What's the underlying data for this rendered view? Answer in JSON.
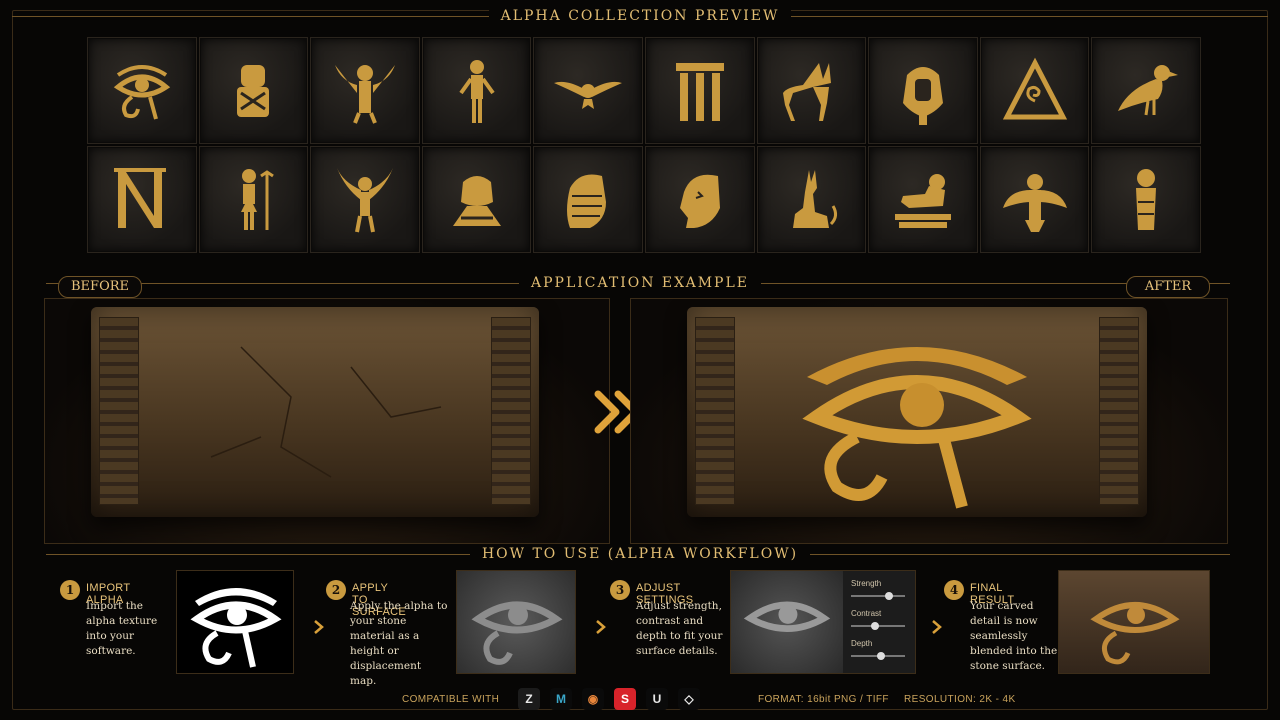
{
  "collection": {
    "title": "ALPHA COLLECTION PREVIEW",
    "icons": [
      "eye-of-horus-icon",
      "seated-pharaoh-icon",
      "winged-figure-icon",
      "standing-god-icon",
      "winged-scarab-icon",
      "column-icon",
      "anubis-jackal-icon",
      "pharaoh-mask-icon",
      "triangle-spiral-icon",
      "falcon-icon",
      "n-letter-icon",
      "standing-figure-staff-icon",
      "winged-goddess-icon",
      "pharaoh-arms-crossed-icon",
      "pharaoh-profile-icon",
      "queen-profile-icon",
      "sitting-jackal-icon",
      "sphinx-icon",
      "winged-idol-icon",
      "mummy-icon"
    ]
  },
  "application": {
    "title": "APPLICATION EXAMPLE",
    "before_label": "BEFORE",
    "after_label": "AFTER"
  },
  "workflow": {
    "title": "HOW TO USE (ALPHA WORKFLOW)",
    "steps": [
      {
        "number": "1",
        "title": "IMPORT ALPHA",
        "description": "Import the alpha texture into your software."
      },
      {
        "number": "2",
        "title": "APPLY TO SURFACE",
        "description": "Apply the alpha to your stone material as a height or displacement map."
      },
      {
        "number": "3",
        "title": "ADJUST SETTINGS",
        "description": "Adjust strength, contrast and depth to fit your surface details."
      },
      {
        "number": "4",
        "title": "FINAL RESULT",
        "description": "Your carved detail is now seamlessly blended into the stone surface."
      }
    ],
    "sliders": [
      {
        "label": "Strength",
        "value": 0.7
      },
      {
        "label": "Contrast",
        "value": 0.45
      },
      {
        "label": "Depth",
        "value": 0.55
      }
    ]
  },
  "footer": {
    "compatible_label": "COMPATIBLE WITH",
    "software": [
      {
        "name": "zbrush-icon",
        "glyph": "Z",
        "bg": "#1b1b1b",
        "fg": "#e8e8e8"
      },
      {
        "name": "maya-icon",
        "glyph": "M",
        "bg": "#0a0a0a",
        "fg": "#3aa7c9"
      },
      {
        "name": "blender-icon",
        "glyph": "◉",
        "bg": "#0a0a0a",
        "fg": "#e8853a"
      },
      {
        "name": "substance-icon",
        "glyph": "S",
        "bg": "#d8232a",
        "fg": "#ffffff"
      },
      {
        "name": "unreal-icon",
        "glyph": "U",
        "bg": "#0a0a0a",
        "fg": "#e8e8e8"
      },
      {
        "name": "unity-icon",
        "glyph": "◇",
        "bg": "#0a0a0a",
        "fg": "#e8e8e8"
      }
    ],
    "format": "FORMAT: 16bit PNG / TIFF",
    "resolution": "RESOLUTION: 2K - 4K"
  },
  "colors": {
    "gold": "#c99a3f",
    "gold_light": "#e7c37c",
    "background": "#070605"
  }
}
